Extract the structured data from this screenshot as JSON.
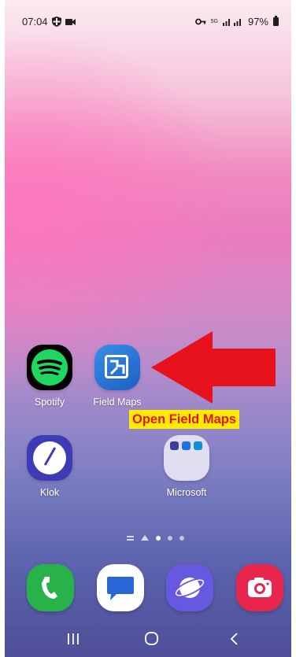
{
  "status_bar": {
    "time": "07:04",
    "network": "5G",
    "battery": "97%"
  },
  "apps": {
    "spotify": {
      "label": "Spotify"
    },
    "field_maps": {
      "label": "Field Maps"
    },
    "klok": {
      "label": "Klok"
    },
    "microsoft_folder": {
      "label": "Microsoft"
    }
  },
  "annotation": {
    "callout": "Open Field Maps",
    "callout_bg": "#ffeb00",
    "callout_text_color": "#e0161e",
    "arrow_color": "#e8121c"
  },
  "page_indicator": {
    "pages": 4,
    "active_index": 0
  },
  "dock": {
    "apps": [
      "phone-icon",
      "messages-icon",
      "internet-icon",
      "camera-icon"
    ]
  },
  "nav_bar": {
    "buttons": [
      "recent-apps-icon",
      "home-icon",
      "back-icon"
    ]
  }
}
